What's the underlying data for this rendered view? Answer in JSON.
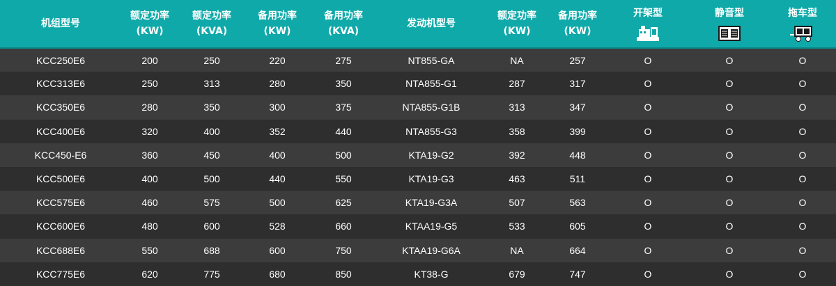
{
  "columns": [
    {
      "label": "机组型号",
      "unit": ""
    },
    {
      "label": "额定功率",
      "unit": "(KW)"
    },
    {
      "label": "额定功率",
      "unit": "(KVA)"
    },
    {
      "label": "备用功率",
      "unit": "(KW)"
    },
    {
      "label": "备用功率",
      "unit": "(KVA)"
    },
    {
      "label": "发动机型号",
      "unit": ""
    },
    {
      "label": "额定功率",
      "unit": "(KW)"
    },
    {
      "label": "备用功率",
      "unit": "(KW)"
    },
    {
      "label": "开架型",
      "unit": "",
      "icon": "open-frame-generator-icon"
    },
    {
      "label": "静音型",
      "unit": "",
      "icon": "silent-generator-icon"
    },
    {
      "label": "拖车型",
      "unit": "",
      "icon": "trailer-generator-icon"
    }
  ],
  "rows": [
    [
      "KCC250E6",
      "200",
      "250",
      "220",
      "275",
      "NT855-GA",
      "NA",
      "257",
      "O",
      "O",
      "O"
    ],
    [
      "KCC313E6",
      "250",
      "313",
      "280",
      "350",
      "NTA855-G1",
      "287",
      "317",
      "O",
      "O",
      "O"
    ],
    [
      "KCC350E6",
      "280",
      "350",
      "300",
      "375",
      "NTA855-G1B",
      "313",
      "347",
      "O",
      "O",
      "O"
    ],
    [
      "KCC400E6",
      "320",
      "400",
      "352",
      "440",
      "NTA855-G3",
      "358",
      "399",
      "O",
      "O",
      "O"
    ],
    [
      "KCC450-E6",
      "360",
      "450",
      "400",
      "500",
      "KTA19-G2",
      "392",
      "448",
      "O",
      "O",
      "O"
    ],
    [
      "KCC500E6",
      "400",
      "500",
      "440",
      "550",
      "KTA19-G3",
      "463",
      "511",
      "O",
      "O",
      "O"
    ],
    [
      "KCC575E6",
      "460",
      "575",
      "500",
      "625",
      "KTA19-G3A",
      "507",
      "563",
      "O",
      "O",
      "O"
    ],
    [
      "KCC600E6",
      "480",
      "600",
      "528",
      "660",
      "KTAA19-G5",
      "533",
      "605",
      "O",
      "O",
      "O"
    ],
    [
      "KCC688E6",
      "550",
      "688",
      "600",
      "750",
      "KTAA19-G6A",
      "NA",
      "664",
      "O",
      "O",
      "O"
    ],
    [
      "KCC775E6",
      "620",
      "775",
      "680",
      "850",
      "KT38-G",
      "679",
      "747",
      "O",
      "O",
      "O"
    ]
  ],
  "colors": {
    "header_bg": "#0fa9a9",
    "row_odd": "#3c3c3c",
    "row_even": "#2e2e2e",
    "text": "#ffffff"
  }
}
